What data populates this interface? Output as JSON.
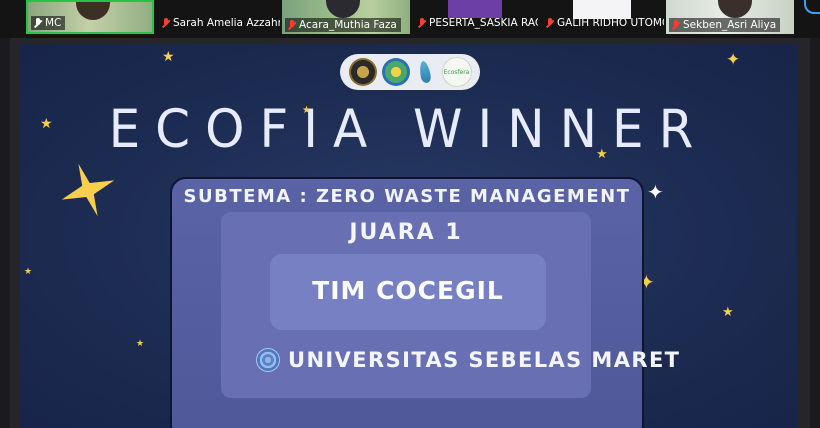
{
  "participants": [
    {
      "name": "MC",
      "muted": false,
      "active": true
    },
    {
      "name": "Sarah Amelia Azzahra",
      "muted": true
    },
    {
      "name": "Acara_Muthia Faza",
      "muted": true
    },
    {
      "name": "PESERTA_SASKIA RAC...",
      "muted": true
    },
    {
      "name": "GALIH RIDHO UTOMO",
      "muted": true
    },
    {
      "name": "Sekben_Asri Aliya",
      "muted": true
    }
  ],
  "slide": {
    "title": "ECOFIA WINNER",
    "subtema": "SUBTEMA : ZERO WASTE MANAGEMENT",
    "rank": "JUARA 1",
    "team": "TIM COCEGIL",
    "university": "UNIVERSITAS SEBELAS MARET",
    "logo4_text": "Ecosfera"
  },
  "colors": {
    "slide_bg": "#1d2c52",
    "panel": "#5a63a6",
    "star": "#f7cf4a",
    "active_border": "#27c24a",
    "muted_icon": "#ff3b30"
  }
}
